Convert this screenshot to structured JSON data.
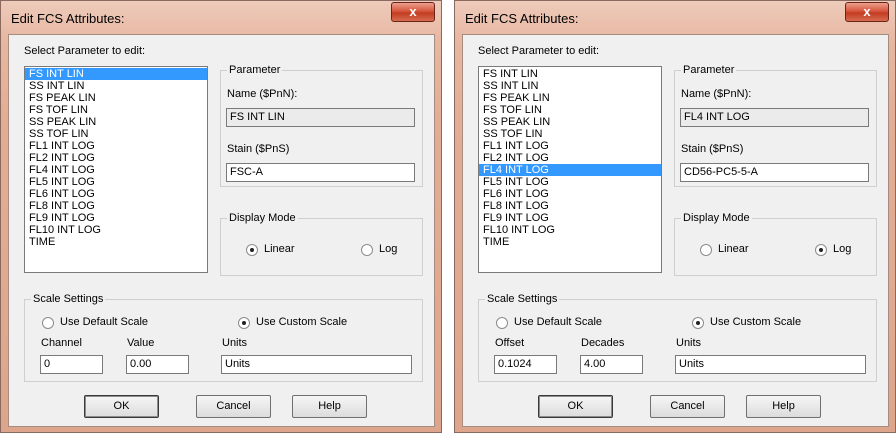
{
  "dialogs": [
    {
      "title": "Edit FCS Attributes:",
      "close_label": "x",
      "select_label": "Select Parameter to edit:",
      "parameters": [
        "FS INT LIN",
        "SS INT LIN",
        "FS PEAK LIN",
        "FS TOF LIN",
        "SS PEAK LIN",
        "SS TOF LIN",
        "FL1 INT LOG",
        "FL2 INT LOG",
        "FL4 INT LOG",
        "FL5 INT LOG",
        "FL6 INT LOG",
        "FL8 INT LOG",
        "FL9 INT LOG",
        "FL10 INT LOG",
        "TIME"
      ],
      "selected_index": 0,
      "parameter_group": {
        "title": "Parameter",
        "name_label": "Name ($PnN):",
        "name_value": "FS INT LIN",
        "stain_label": "Stain ($PnS)",
        "stain_value": "FSC-A"
      },
      "display_mode": {
        "title": "Display Mode",
        "linear_label": "Linear",
        "log_label": "Log",
        "selected": "Linear"
      },
      "scale_settings": {
        "title": "Scale Settings",
        "default_label": "Use Default Scale",
        "custom_label": "Use Custom Scale",
        "selected": "custom",
        "field1_label": "Channel",
        "field1_value": "0",
        "field2_label": "Value",
        "field2_value": "0.00",
        "units_label": "Units",
        "units_value": "Units"
      },
      "buttons": {
        "ok": "OK",
        "cancel": "Cancel",
        "help": "Help"
      }
    },
    {
      "title": "Edit FCS Attributes:",
      "close_label": "x",
      "select_label": "Select Parameter to edit:",
      "parameters": [
        "FS INT LIN",
        "SS INT LIN",
        "FS PEAK LIN",
        "FS TOF LIN",
        "SS PEAK LIN",
        "SS TOF LIN",
        "FL1 INT LOG",
        "FL2 INT LOG",
        "FL4 INT LOG",
        "FL5 INT LOG",
        "FL6 INT LOG",
        "FL8 INT LOG",
        "FL9 INT LOG",
        "FL10 INT LOG",
        "TIME"
      ],
      "selected_index": 8,
      "parameter_group": {
        "title": "Parameter",
        "name_label": "Name ($PnN):",
        "name_value": "FL4 INT LOG",
        "stain_label": "Stain ($PnS)",
        "stain_value": "CD56-PC5-5-A"
      },
      "display_mode": {
        "title": "Display Mode",
        "linear_label": "Linear",
        "log_label": "Log",
        "selected": "Log"
      },
      "scale_settings": {
        "title": "Scale Settings",
        "default_label": "Use Default Scale",
        "custom_label": "Use Custom Scale",
        "selected": "custom",
        "field1_label": "Offset",
        "field1_value": "0.1024",
        "field2_label": "Decades",
        "field2_value": "4.00",
        "units_label": "Units",
        "units_value": "Units"
      },
      "buttons": {
        "ok": "OK",
        "cancel": "Cancel",
        "help": "Help"
      }
    }
  ]
}
